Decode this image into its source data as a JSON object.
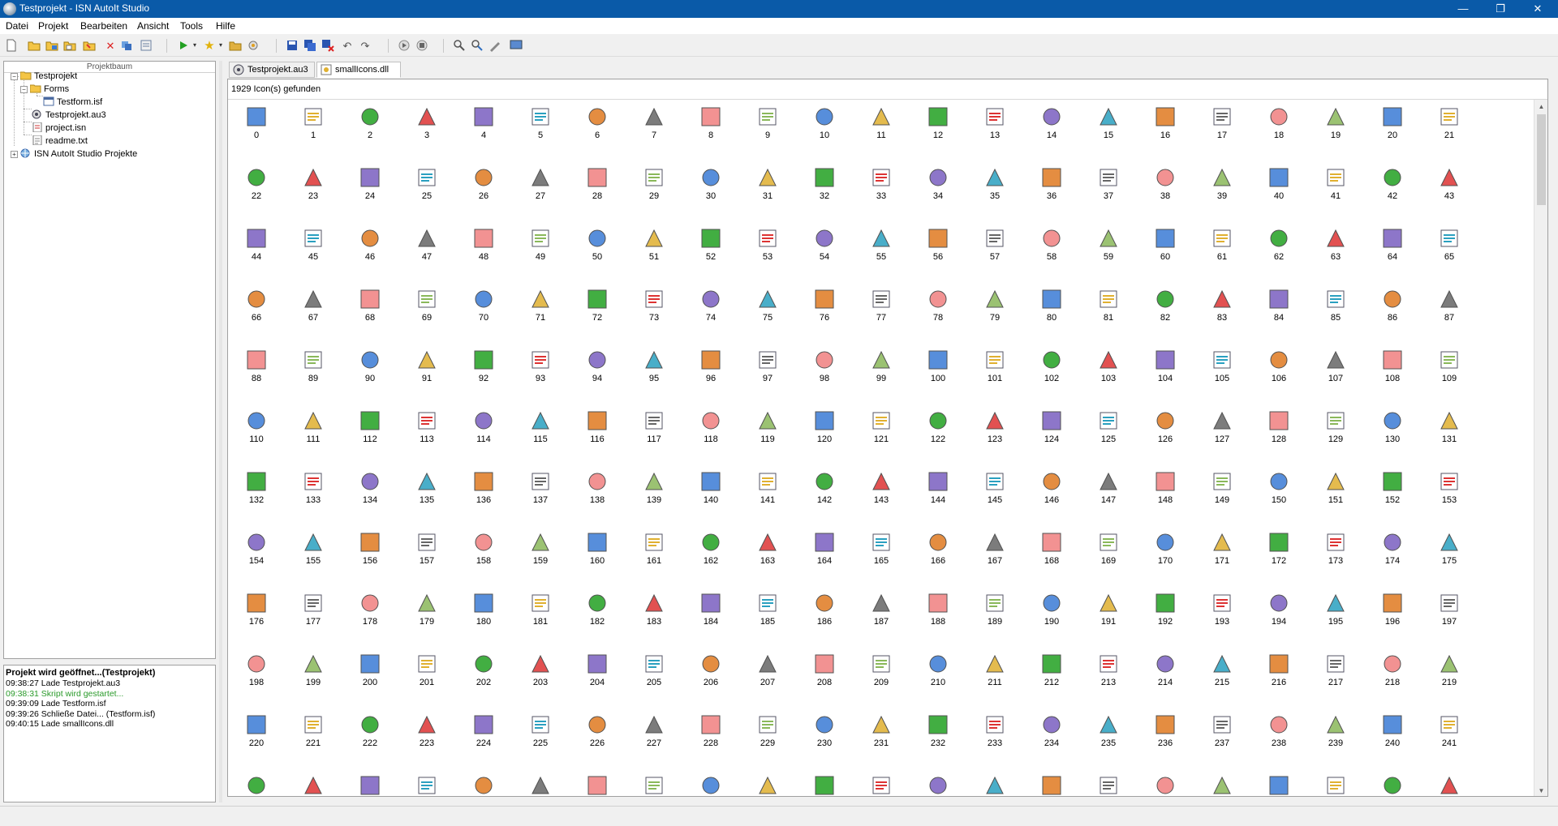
{
  "window": {
    "title": "Testprojekt - ISN AutoIt Studio",
    "min": "—",
    "max": "❐",
    "close": "✕"
  },
  "menu": [
    "Datei",
    "Projekt",
    "Bearbeiten",
    "Ansicht",
    "Tools",
    "Hilfe"
  ],
  "toolbar_icons": [
    "new-file-icon",
    "open-folder-icon",
    "open-project-icon",
    "save-all-icon",
    "import-icon",
    "delete-icon",
    "refresh-icon",
    "settings-icon",
    "run-icon",
    "favorites-icon",
    "compile-icon",
    "tools-icon",
    "save-icon",
    "save-as-icon",
    "close-file-icon",
    "undo-icon",
    "redo-icon",
    "step-icon",
    "stop-icon",
    "search-icon",
    "replace-icon",
    "pen-icon",
    "monitor-icon"
  ],
  "project_tree": {
    "header": "Projektbaum",
    "items": [
      {
        "label": "Testprojekt",
        "icon": "folder-open-icon"
      },
      {
        "label": "Forms",
        "icon": "folder-icon"
      },
      {
        "label": "Testform.isf",
        "icon": "form-file-icon"
      },
      {
        "label": "Testprojekt.au3",
        "icon": "autoit-file-icon"
      },
      {
        "label": "project.isn",
        "icon": "project-file-icon"
      },
      {
        "label": "readme.txt",
        "icon": "text-file-icon"
      },
      {
        "label": "ISN AutoIt Studio Projekte",
        "icon": "globe-icon"
      }
    ]
  },
  "log": {
    "heading": "Projekt wird geöffnet...(Testprojekt)",
    "lines": [
      {
        "text": "09:38:27  Lade Testprojekt.au3",
        "color": "#000000"
      },
      {
        "text": "09:38:31  Skript wird gestartet...",
        "color": "#2a9a2a"
      },
      {
        "text": "09:39:09  Lade Testform.isf",
        "color": "#000000"
      },
      {
        "text": "09:39:26  Schließe Datei... (Testform.isf)",
        "color": "#000000"
      },
      {
        "text": "09:40:15  Lade smallIcons.dll",
        "color": "#000000"
      }
    ]
  },
  "tabs": [
    {
      "label": "Testprojekt.au3",
      "active": false
    },
    {
      "label": "smallIcons.dll",
      "active": true
    }
  ],
  "viewer": {
    "status": "1929 Icon(s) gefunden",
    "first_icon_index": 0,
    "columns": 22,
    "visible_rows": 12,
    "last_row_label_hidden": true
  },
  "colors": {
    "accent": "#0a5aa8",
    "background": "#f0f0f0",
    "log_green": "#2a9a2a"
  }
}
